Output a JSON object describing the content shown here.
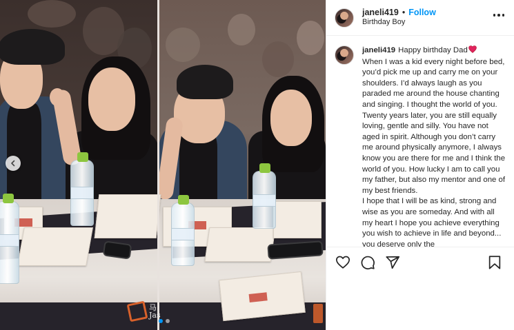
{
  "post": {
    "author": "janeli419",
    "separator": "•",
    "follow_label": "Follow",
    "location": "Birthday Boy",
    "caption_lines": {
      "greeting": "Happy birthday Dad",
      "p1": "When I was a kid every night before bed, you’d pick me up and carry me on your shoulders. I’d always laugh as you paraded me around the house chanting and singing. I thought the world of you. Twenty years later, you are still equally loving, gentle and silly. You have not aged in spirit. Although you don’t carry me around physically anymore, I always know you are there for me and I think the world of you. How lucky I am to call you my father, but also my mentor and one of my best friends.",
      "p2": "I hope that I will be as kind, strong and wise as you are someday. And with all my heart I hope you achieve everything you wish to achieve in life and beyond... you deserve only the"
    },
    "icons": {
      "more": "more-options-icon",
      "heart_emoji": "red-heart-emoji",
      "like": "heart-icon",
      "comment": "comment-icon",
      "share": "share-icon",
      "save": "bookmark-icon",
      "prev": "chevron-left-icon"
    }
  },
  "carousel": {
    "slide_count": 2,
    "active_index": 1,
    "watermark_text": "马\nJas"
  },
  "colors": {
    "accent": "#0095f6",
    "heart": "#ed4956",
    "text": "#262626"
  }
}
